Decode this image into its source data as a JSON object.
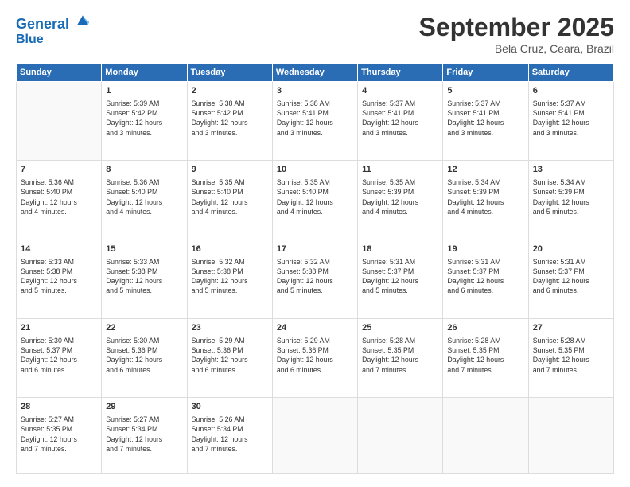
{
  "header": {
    "logo_line1": "General",
    "logo_line2": "Blue",
    "month_title": "September 2025",
    "location": "Bela Cruz, Ceara, Brazil"
  },
  "days_of_week": [
    "Sunday",
    "Monday",
    "Tuesday",
    "Wednesday",
    "Thursday",
    "Friday",
    "Saturday"
  ],
  "weeks": [
    [
      {
        "num": "",
        "info": ""
      },
      {
        "num": "1",
        "info": "Sunrise: 5:39 AM\nSunset: 5:42 PM\nDaylight: 12 hours\nand 3 minutes."
      },
      {
        "num": "2",
        "info": "Sunrise: 5:38 AM\nSunset: 5:42 PM\nDaylight: 12 hours\nand 3 minutes."
      },
      {
        "num": "3",
        "info": "Sunrise: 5:38 AM\nSunset: 5:41 PM\nDaylight: 12 hours\nand 3 minutes."
      },
      {
        "num": "4",
        "info": "Sunrise: 5:37 AM\nSunset: 5:41 PM\nDaylight: 12 hours\nand 3 minutes."
      },
      {
        "num": "5",
        "info": "Sunrise: 5:37 AM\nSunset: 5:41 PM\nDaylight: 12 hours\nand 3 minutes."
      },
      {
        "num": "6",
        "info": "Sunrise: 5:37 AM\nSunset: 5:41 PM\nDaylight: 12 hours\nand 3 minutes."
      }
    ],
    [
      {
        "num": "7",
        "info": "Sunrise: 5:36 AM\nSunset: 5:40 PM\nDaylight: 12 hours\nand 4 minutes."
      },
      {
        "num": "8",
        "info": "Sunrise: 5:36 AM\nSunset: 5:40 PM\nDaylight: 12 hours\nand 4 minutes."
      },
      {
        "num": "9",
        "info": "Sunrise: 5:35 AM\nSunset: 5:40 PM\nDaylight: 12 hours\nand 4 minutes."
      },
      {
        "num": "10",
        "info": "Sunrise: 5:35 AM\nSunset: 5:40 PM\nDaylight: 12 hours\nand 4 minutes."
      },
      {
        "num": "11",
        "info": "Sunrise: 5:35 AM\nSunset: 5:39 PM\nDaylight: 12 hours\nand 4 minutes."
      },
      {
        "num": "12",
        "info": "Sunrise: 5:34 AM\nSunset: 5:39 PM\nDaylight: 12 hours\nand 4 minutes."
      },
      {
        "num": "13",
        "info": "Sunrise: 5:34 AM\nSunset: 5:39 PM\nDaylight: 12 hours\nand 5 minutes."
      }
    ],
    [
      {
        "num": "14",
        "info": "Sunrise: 5:33 AM\nSunset: 5:38 PM\nDaylight: 12 hours\nand 5 minutes."
      },
      {
        "num": "15",
        "info": "Sunrise: 5:33 AM\nSunset: 5:38 PM\nDaylight: 12 hours\nand 5 minutes."
      },
      {
        "num": "16",
        "info": "Sunrise: 5:32 AM\nSunset: 5:38 PM\nDaylight: 12 hours\nand 5 minutes."
      },
      {
        "num": "17",
        "info": "Sunrise: 5:32 AM\nSunset: 5:38 PM\nDaylight: 12 hours\nand 5 minutes."
      },
      {
        "num": "18",
        "info": "Sunrise: 5:31 AM\nSunset: 5:37 PM\nDaylight: 12 hours\nand 5 minutes."
      },
      {
        "num": "19",
        "info": "Sunrise: 5:31 AM\nSunset: 5:37 PM\nDaylight: 12 hours\nand 6 minutes."
      },
      {
        "num": "20",
        "info": "Sunrise: 5:31 AM\nSunset: 5:37 PM\nDaylight: 12 hours\nand 6 minutes."
      }
    ],
    [
      {
        "num": "21",
        "info": "Sunrise: 5:30 AM\nSunset: 5:37 PM\nDaylight: 12 hours\nand 6 minutes."
      },
      {
        "num": "22",
        "info": "Sunrise: 5:30 AM\nSunset: 5:36 PM\nDaylight: 12 hours\nand 6 minutes."
      },
      {
        "num": "23",
        "info": "Sunrise: 5:29 AM\nSunset: 5:36 PM\nDaylight: 12 hours\nand 6 minutes."
      },
      {
        "num": "24",
        "info": "Sunrise: 5:29 AM\nSunset: 5:36 PM\nDaylight: 12 hours\nand 6 minutes."
      },
      {
        "num": "25",
        "info": "Sunrise: 5:28 AM\nSunset: 5:35 PM\nDaylight: 12 hours\nand 7 minutes."
      },
      {
        "num": "26",
        "info": "Sunrise: 5:28 AM\nSunset: 5:35 PM\nDaylight: 12 hours\nand 7 minutes."
      },
      {
        "num": "27",
        "info": "Sunrise: 5:28 AM\nSunset: 5:35 PM\nDaylight: 12 hours\nand 7 minutes."
      }
    ],
    [
      {
        "num": "28",
        "info": "Sunrise: 5:27 AM\nSunset: 5:35 PM\nDaylight: 12 hours\nand 7 minutes."
      },
      {
        "num": "29",
        "info": "Sunrise: 5:27 AM\nSunset: 5:34 PM\nDaylight: 12 hours\nand 7 minutes."
      },
      {
        "num": "30",
        "info": "Sunrise: 5:26 AM\nSunset: 5:34 PM\nDaylight: 12 hours\nand 7 minutes."
      },
      {
        "num": "",
        "info": ""
      },
      {
        "num": "",
        "info": ""
      },
      {
        "num": "",
        "info": ""
      },
      {
        "num": "",
        "info": ""
      }
    ]
  ]
}
